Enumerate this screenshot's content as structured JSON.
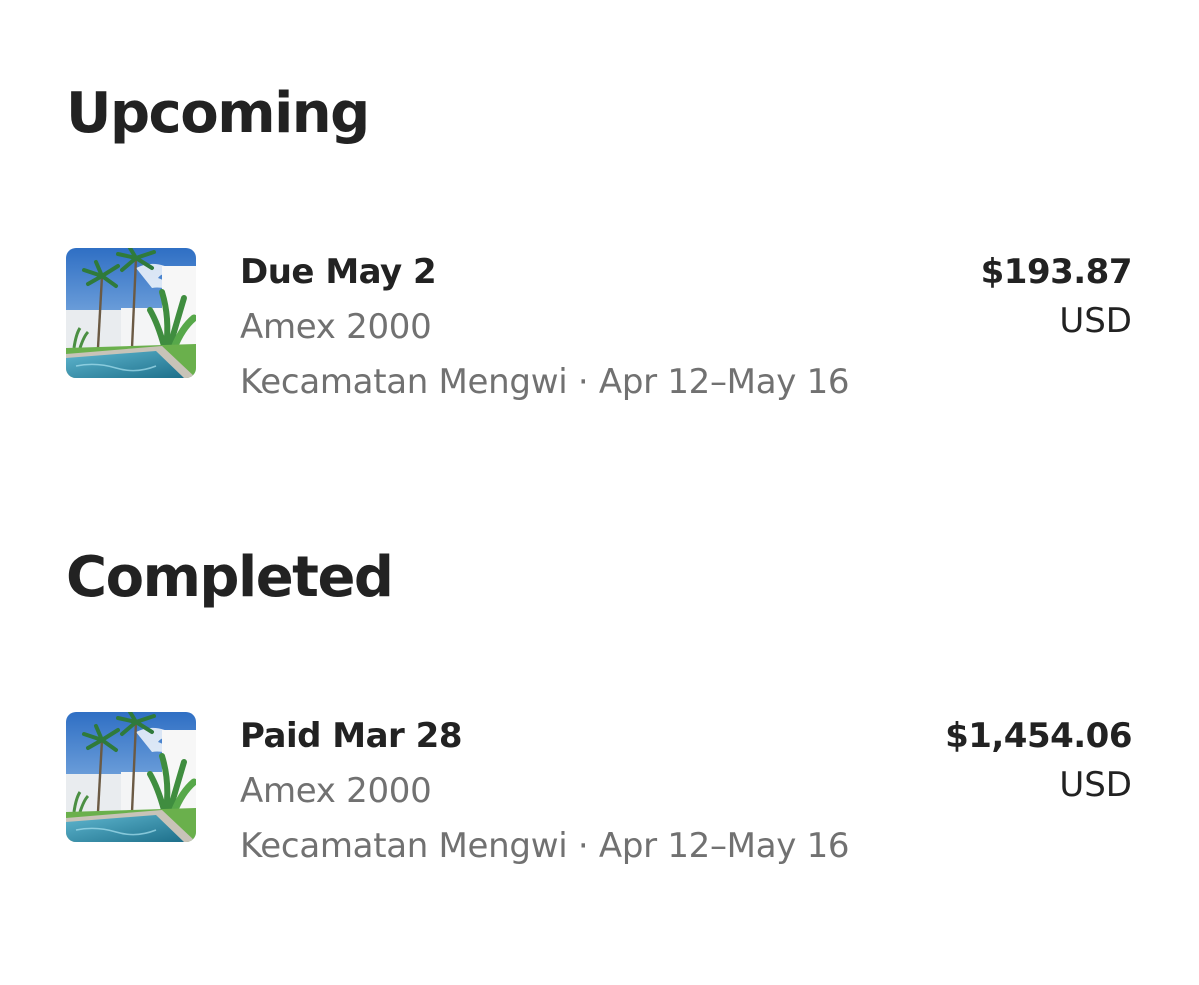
{
  "sections": [
    {
      "title": "Upcoming",
      "payment": {
        "status": "Due May 2",
        "card": "Amex 2000",
        "listing": "Kecamatan Mengwi · Apr 12–May 16",
        "amount": "$193.87",
        "currency": "USD",
        "thumbnail": "villa-pool-photo"
      }
    },
    {
      "title": "Completed",
      "payment": {
        "status": "Paid Mar 28",
        "card": "Amex 2000",
        "listing": "Kecamatan Mengwi · Apr 12–May 16",
        "amount": "$1,454.06",
        "currency": "USD",
        "thumbnail": "villa-pool-photo"
      }
    }
  ],
  "colors": {
    "primary_text": "#222222",
    "secondary_text": "#717171",
    "background": "#ffffff"
  }
}
